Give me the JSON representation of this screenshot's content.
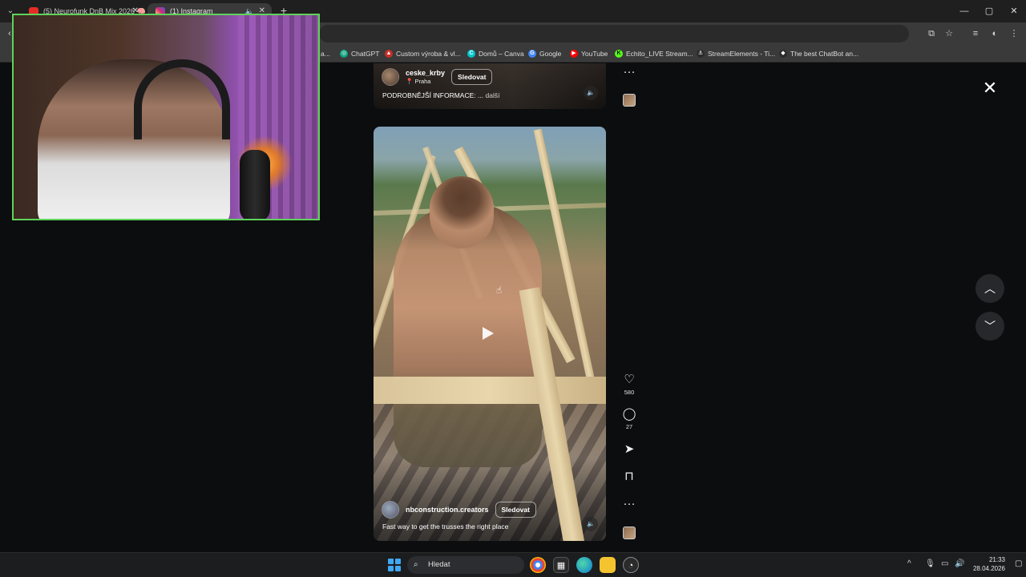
{
  "browser": {
    "tabs": [
      {
        "label": "(5) Neurofunk DnB Mix 2026 🧠",
        "favicon_color": "#e52d27"
      },
      {
        "label": "(1) Instagram",
        "favicon_color": "#d62976"
      }
    ],
    "new_tab_symbol": "+",
    "window_controls": [
      "—",
      "▢",
      "✕"
    ],
    "bookmarks": [
      {
        "label": "a...",
        "icon": "bookmark-fragment-icon",
        "color": "#5a5a5a",
        "glyph": ""
      },
      {
        "label": "ChatGPT",
        "icon": "chatgpt-icon",
        "color": "#10a37f",
        "glyph": "◎"
      },
      {
        "label": "Custom výroba & vl...",
        "icon": "custom-vyroba-icon",
        "color": "#c4302b",
        "glyph": "▲"
      },
      {
        "label": "Domů – Canva",
        "icon": "canva-icon",
        "color": "#00c4cc",
        "glyph": "C"
      },
      {
        "label": "Google",
        "icon": "google-icon",
        "color": "#4285f4",
        "glyph": "G"
      },
      {
        "label": "YouTube",
        "icon": "youtube-icon",
        "color": "#ff0000",
        "glyph": "▶"
      },
      {
        "label": "Echito_LIVE Stream...",
        "icon": "kick-icon",
        "color": "#53fc18",
        "glyph": "K"
      },
      {
        "label": "StreamElements - Ti...",
        "icon": "streamelements-icon",
        "color": "#2b2b2b",
        "glyph": "⚓"
      },
      {
        "label": "The best ChatBot an...",
        "icon": "chatbot-icon",
        "color": "#2b2b2b",
        "glyph": "◆"
      }
    ]
  },
  "reels": {
    "top": {
      "username": "ceske_krby",
      "location": "Praha",
      "follow_label": "Sledovat",
      "caption": "PODROBNĚJŠÍ INFORMACE: ...",
      "more_label": "další"
    },
    "main": {
      "username": "nbconstruction.creators",
      "follow_label": "Sledovat",
      "caption": "Fast way to get the trusses the right place",
      "likes": "580",
      "comments": "27"
    }
  },
  "taskbar": {
    "search_placeholder": "Hledat",
    "time": "21:33",
    "date": "28.04.2026"
  },
  "icons": {
    "close": "✕",
    "prev": "︿",
    "next": "﹀",
    "more": "···",
    "like": "♡",
    "comment": "◯",
    "share": "➤",
    "save": "⊓",
    "sound": "🔈",
    "search": "⌕"
  }
}
